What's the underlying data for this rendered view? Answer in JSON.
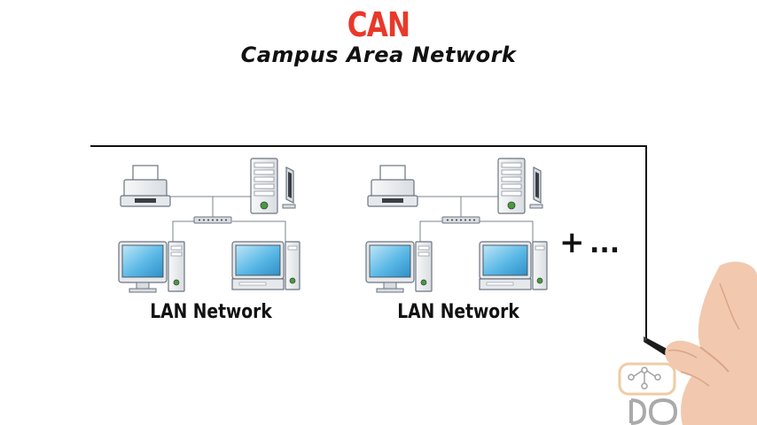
{
  "title": "CAN",
  "subtitle": "Campus Area Network",
  "networks": [
    {
      "label": "LAN Network"
    },
    {
      "label": "LAN Network"
    }
  ],
  "more": {
    "plus": "+",
    "ellipsis": "..."
  },
  "colors": {
    "title": "#e8392a",
    "screen": "#5ab8e6",
    "device_body": "#eef0f2",
    "outline": "#6b7480"
  },
  "icons": [
    "printer-icon",
    "server-tower-icon",
    "switch-icon",
    "desktop-computer-icon",
    "hand-with-pen",
    "watermark-logo"
  ]
}
